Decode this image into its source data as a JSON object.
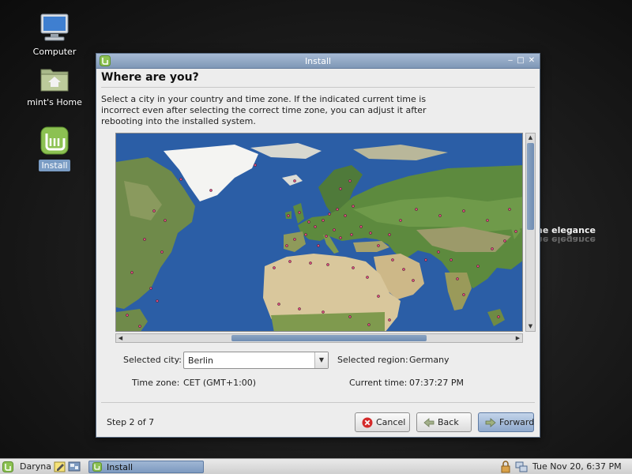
{
  "desktop": {
    "icons": [
      {
        "label": "Computer",
        "icon": "computer-icon"
      },
      {
        "label": "mint's Home",
        "icon": "home-folder-icon"
      },
      {
        "label": "Install",
        "icon": "mint-install-icon",
        "selected": true
      }
    ],
    "wallpaper_text": "he elegance",
    "wallpaper_text_mirror": "he elegance"
  },
  "window": {
    "title": "Install",
    "controls": [
      "minimize-icon",
      "maximize-icon",
      "close-icon"
    ],
    "heading": "Where are you?",
    "intro": "Select a city in your country and time zone. If the indicated current time is incorrect even after selecting the correct time zone, you can adjust it after rebooting into the installed system.",
    "map": {
      "view": "world map centered on Europe / Middle East",
      "water_color": "#2b5ea6",
      "city_marker_color": "#d94a7a"
    },
    "form": {
      "selected_city_label": "Selected city:",
      "selected_city_value": "Berlin",
      "selected_region_label": "Selected region:",
      "selected_region_value": "Germany",
      "time_zone_label": "Time zone:",
      "time_zone_value": "CET (GMT+1:00)",
      "current_time_label": "Current time:",
      "current_time_value": "07:37:27 PM"
    },
    "footer": {
      "step": "Step 2 of 7",
      "cancel": "Cancel",
      "back": "Back",
      "forward": "Forward"
    }
  },
  "taskbar": {
    "menu_label": "Daryna",
    "task_label": "Install",
    "clock": "Tue Nov 20,  6:37 PM"
  },
  "colors": {
    "accent": "#7d9ac0",
    "titlebar": "#8fa6c4",
    "cancel_icon": "#d42a2a",
    "mint_green": "#8cc152"
  }
}
